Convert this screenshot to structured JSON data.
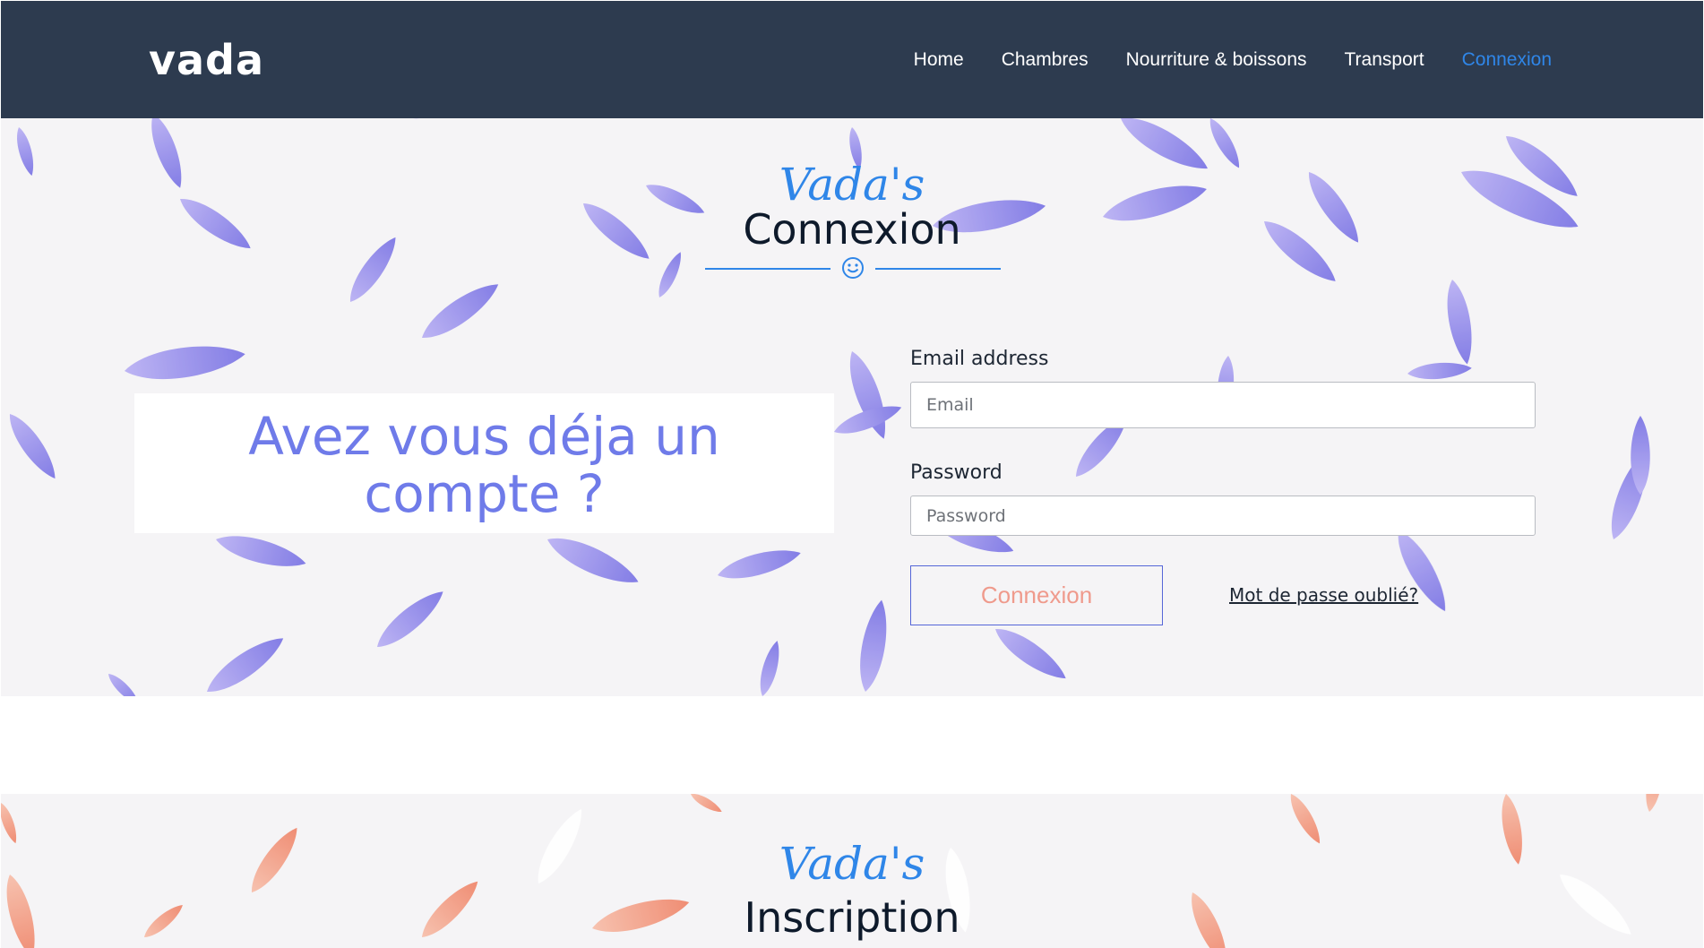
{
  "nav": {
    "brand": "vada",
    "links": [
      "Home",
      "Chambres",
      "Nourriture & boissons",
      "Transport",
      "Connexion"
    ],
    "active_index": 4
  },
  "login": {
    "script_title": "Vada's",
    "title": "Connexion",
    "question": "Avez vous déja un compte ?",
    "email_label": "Email address",
    "email_placeholder": "Email",
    "password_label": "Password",
    "password_placeholder": "Password",
    "submit_label": "Connexion",
    "forgot_label": "Mot de passe oublié?"
  },
  "signup": {
    "script_title": "Vada's",
    "title": "Inscription"
  },
  "colors": {
    "navbar": "#2d3b4f",
    "accent": "#2f86e8",
    "question_text": "#6f7be9",
    "button_text": "#ef9a8c",
    "petal_purple": "#8f86ec",
    "petal_orange": "#f08a72"
  }
}
